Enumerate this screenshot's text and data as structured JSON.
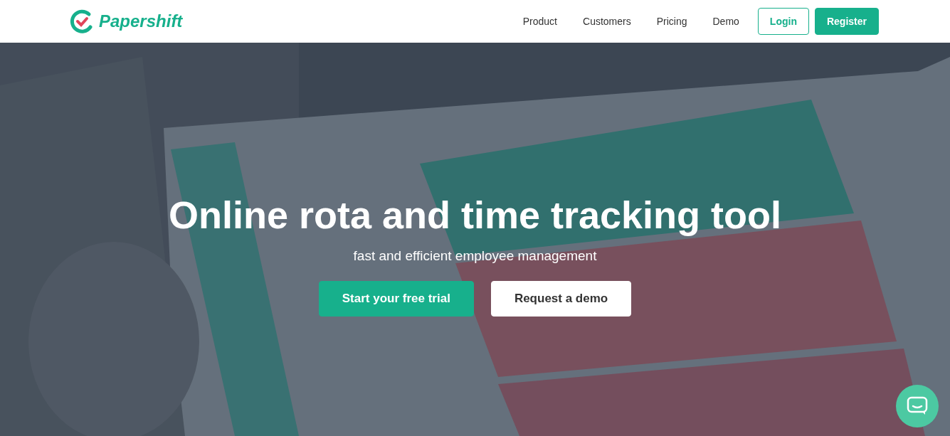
{
  "header": {
    "logo": "Papershift",
    "nav": [
      {
        "label": "Product"
      },
      {
        "label": "Customers"
      },
      {
        "label": "Pricing"
      },
      {
        "label": "Demo"
      }
    ],
    "buttons": [
      {
        "label": "Login",
        "kind": "outline"
      },
      {
        "label": "Register",
        "kind": "solid"
      }
    ]
  },
  "hero": {
    "title": "Online rota and time tracking tool",
    "subtitle": "fast and efficient employee management",
    "buttons": [
      {
        "label": "Start your free trial",
        "kind": "solid"
      },
      {
        "label": "Request a demo",
        "kind": "white"
      }
    ]
  }
}
